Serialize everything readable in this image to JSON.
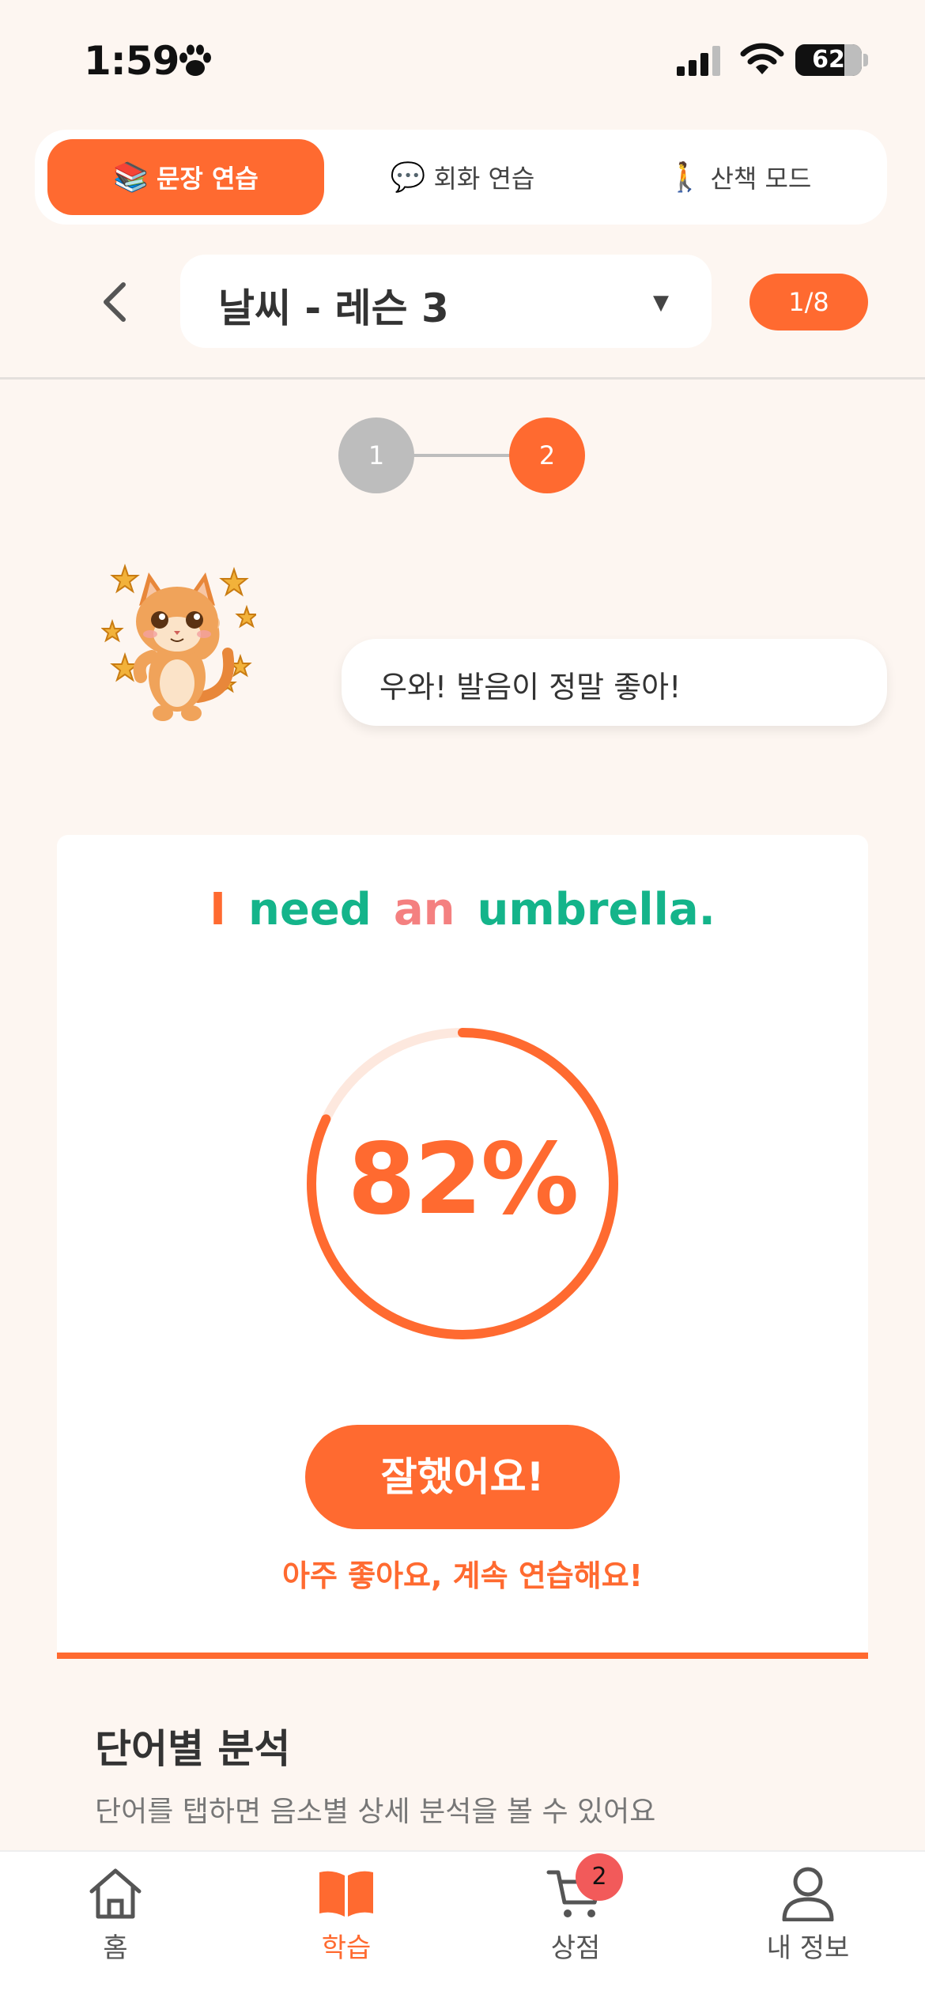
{
  "status_bar": {
    "time": "1:59",
    "battery": "62"
  },
  "mode_tabs": [
    {
      "emoji": "📚",
      "label": "문장 연습",
      "active": true
    },
    {
      "emoji": "💬",
      "label": "회화 연습",
      "active": false
    },
    {
      "emoji": "🚶",
      "label": "산책 모드",
      "active": false
    }
  ],
  "lesson": {
    "title": "날씨 - 레슨 3",
    "counter": "1/8"
  },
  "steps": [
    "1",
    "2"
  ],
  "speech_bubble": "우와! 발음이 정말 좋아!",
  "sentence_words": [
    {
      "text": "I",
      "color": "#ff6a30"
    },
    {
      "text": "need",
      "color": "#14b48a"
    },
    {
      "text": "an",
      "color": "#f48080"
    },
    {
      "text": "umbrella.",
      "color": "#14b48a"
    }
  ],
  "score": {
    "label": "82%",
    "value": 82
  },
  "result": {
    "button": "잘했어요!",
    "message": "아주 좋아요, 계속 연습해요!"
  },
  "analysis": {
    "title": "단어별 분석",
    "subtitle": "단어를 탭하면 음소별 상세 분석을 볼 수 있어요"
  },
  "bottom_nav": [
    {
      "label": "홈",
      "icon": "home-icon"
    },
    {
      "label": "학습",
      "icon": "book-icon",
      "active": true
    },
    {
      "label": "상점",
      "icon": "cart-icon",
      "badge": "2"
    },
    {
      "label": "내 정보",
      "icon": "user-icon"
    }
  ],
  "colors": {
    "accent": "#ff6a30",
    "correct": "#14b48a",
    "partial": "#f48080",
    "background": "#fdf6f1"
  }
}
